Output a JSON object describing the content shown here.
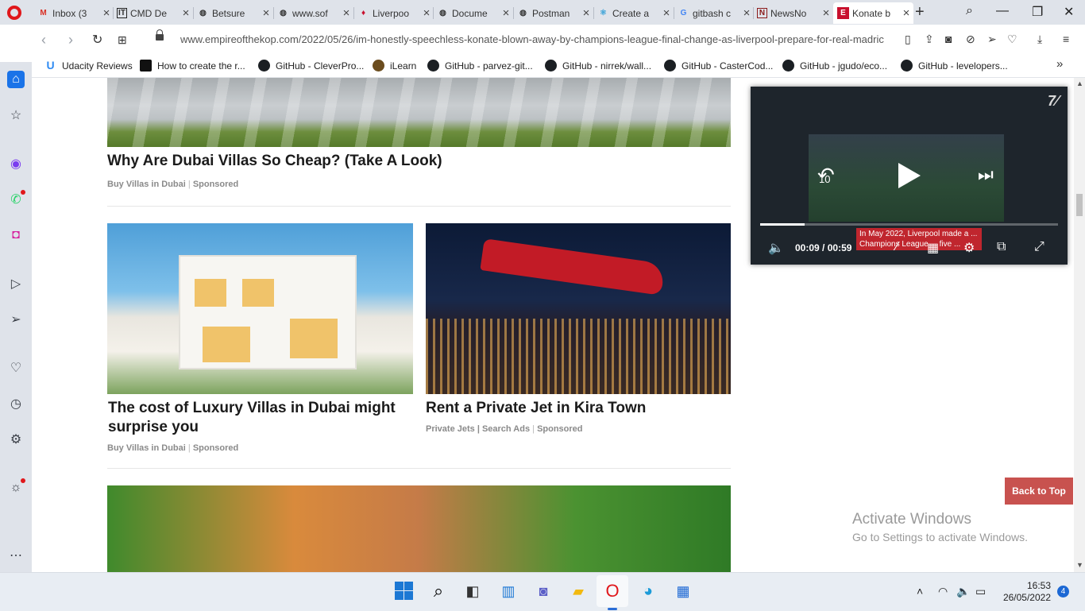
{
  "browser": {
    "tabs": [
      {
        "title": "Inbox (3",
        "icon": "gmail-icon"
      },
      {
        "title": "CMD De",
        "icon": "it-icon"
      },
      {
        "title": "Betsure",
        "icon": "globe-icon"
      },
      {
        "title": "www.sof",
        "icon": "globe-icon"
      },
      {
        "title": "Liverpoo",
        "icon": "liverpool-icon"
      },
      {
        "title": "Docume",
        "icon": "globe-icon"
      },
      {
        "title": "Postman",
        "icon": "globe-icon"
      },
      {
        "title": "Create a",
        "icon": "react-icon"
      },
      {
        "title": "gitbash c",
        "icon": "google-icon"
      },
      {
        "title": "NewsNo",
        "icon": "news-icon"
      },
      {
        "title": "Konate b",
        "icon": "empire-icon"
      }
    ],
    "url": "www.empireofthekop.com/2022/05/26/im-honestly-speechless-konate-blown-away-by-champions-league-final-change-as-liverpool-prepare-for-real-madric",
    "bookmarks": [
      {
        "label": "Udacity Reviews",
        "icon": "udacity-icon"
      },
      {
        "label": "How to create the r...",
        "icon": "dev-icon"
      },
      {
        "label": "GitHub - CleverPro...",
        "icon": "github-icon"
      },
      {
        "label": "iLearn",
        "icon": "ilearn-icon"
      },
      {
        "label": "GitHub - parvez-git...",
        "icon": "github-icon"
      },
      {
        "label": "GitHub - nirrek/wall...",
        "icon": "github-icon"
      },
      {
        "label": "GitHub - CasterCod...",
        "icon": "github-icon"
      },
      {
        "label": "GitHub - jgudo/eco...",
        "icon": "github-icon"
      },
      {
        "label": "GitHub - levelopers...",
        "icon": "github-icon"
      }
    ]
  },
  "ads": [
    {
      "title": "Why Are Dubai Villas So Cheap? (Take A Look)",
      "source": "Buy Villas in Dubai",
      "sponsored": "Sponsored"
    },
    {
      "title": "The cost of Luxury Villas in Dubai might surprise you",
      "source": "Buy Villas in Dubai",
      "sponsored": "Sponsored"
    },
    {
      "title": "Rent a Private Jet in Kira Town",
      "source": "Private Jets | Search Ads",
      "sponsored": "Sponsored"
    }
  ],
  "video": {
    "current_time": "00:09",
    "separator": "/",
    "duration": "00:59",
    "progress": 0.15,
    "rewind_seconds": "10",
    "caption": "In May 2022, Liverpool made a ... Champions League ... five ..."
  },
  "back_to_top": "Back to Top",
  "watermark": {
    "title": "Activate Windows",
    "subtitle": "Go to Settings to activate Windows."
  },
  "taskbar": {
    "time": "16:53",
    "date": "26/05/2022",
    "notifications": "4"
  },
  "colors": {
    "accent": "#1a73e8",
    "back_to_top": "#c8524f",
    "opera_red": "#e0171b"
  }
}
